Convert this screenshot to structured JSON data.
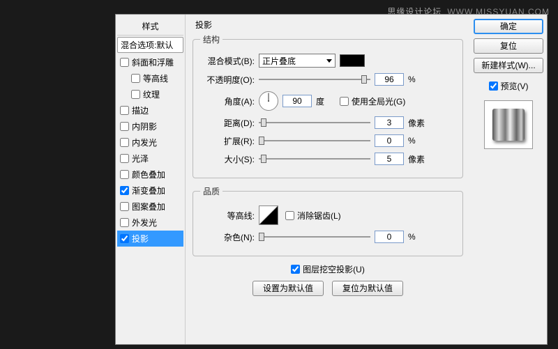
{
  "watermark": {
    "site": "思缘设计论坛",
    "url": "WWW.MISSYUAN.COM"
  },
  "styles": {
    "header": "样式",
    "blend": "混合选项:默认",
    "items": [
      {
        "label": "斜面和浮雕",
        "checked": false,
        "indent": false
      },
      {
        "label": "等高线",
        "checked": false,
        "indent": true
      },
      {
        "label": "纹理",
        "checked": false,
        "indent": true
      },
      {
        "label": "描边",
        "checked": false,
        "indent": false
      },
      {
        "label": "内阴影",
        "checked": false,
        "indent": false
      },
      {
        "label": "内发光",
        "checked": false,
        "indent": false
      },
      {
        "label": "光泽",
        "checked": false,
        "indent": false
      },
      {
        "label": "颜色叠加",
        "checked": false,
        "indent": false
      },
      {
        "label": "渐变叠加",
        "checked": true,
        "indent": false
      },
      {
        "label": "图案叠加",
        "checked": false,
        "indent": false
      },
      {
        "label": "外发光",
        "checked": false,
        "indent": false
      },
      {
        "label": "投影",
        "checked": true,
        "indent": false,
        "selected": true
      }
    ]
  },
  "panel": {
    "title": "投影",
    "structure": {
      "legend": "结构",
      "blendMode": {
        "label": "混合模式(B):",
        "value": "正片叠底"
      },
      "opacity": {
        "label": "不透明度(O):",
        "value": "96",
        "unit": "%",
        "thumb": 92
      },
      "angle": {
        "label": "角度(A):",
        "value": "90",
        "unit": "度"
      },
      "useGlobal": {
        "label": "使用全局光(G)",
        "checked": false
      },
      "distance": {
        "label": "距离(D):",
        "value": "3",
        "unit": "像素",
        "thumb": 2
      },
      "spread": {
        "label": "扩展(R):",
        "value": "0",
        "unit": "%",
        "thumb": 0
      },
      "size": {
        "label": "大小(S):",
        "value": "5",
        "unit": "像素",
        "thumb": 2
      }
    },
    "quality": {
      "legend": "品质",
      "contour": {
        "label": "等高线:"
      },
      "antiAlias": {
        "label": "消除锯齿(L)",
        "checked": false
      },
      "noise": {
        "label": "杂色(N):",
        "value": "0",
        "unit": "%",
        "thumb": 0
      }
    },
    "knockout": {
      "label": "图层挖空投影(U)",
      "checked": true
    },
    "setDefault": "设置为默认值",
    "resetDefault": "复位为默认值"
  },
  "right": {
    "ok": "确定",
    "cancel": "复位",
    "newStyle": "新建样式(W)...",
    "preview": "预览(V)"
  }
}
